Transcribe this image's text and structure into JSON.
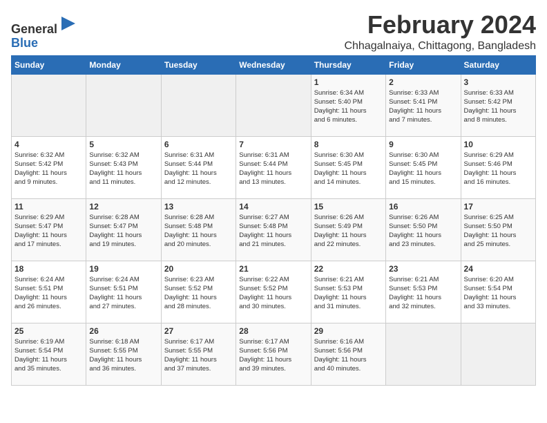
{
  "app": {
    "name_general": "General",
    "name_blue": "Blue"
  },
  "title": "February 2024",
  "location": "Chhagalnaiya, Chittagong, Bangladesh",
  "days_of_week": [
    "Sunday",
    "Monday",
    "Tuesday",
    "Wednesday",
    "Thursday",
    "Friday",
    "Saturday"
  ],
  "weeks": [
    [
      {
        "day": "",
        "info": ""
      },
      {
        "day": "",
        "info": ""
      },
      {
        "day": "",
        "info": ""
      },
      {
        "day": "",
        "info": ""
      },
      {
        "day": "1",
        "info": "Sunrise: 6:34 AM\nSunset: 5:40 PM\nDaylight: 11 hours\nand 6 minutes."
      },
      {
        "day": "2",
        "info": "Sunrise: 6:33 AM\nSunset: 5:41 PM\nDaylight: 11 hours\nand 7 minutes."
      },
      {
        "day": "3",
        "info": "Sunrise: 6:33 AM\nSunset: 5:42 PM\nDaylight: 11 hours\nand 8 minutes."
      }
    ],
    [
      {
        "day": "4",
        "info": "Sunrise: 6:32 AM\nSunset: 5:42 PM\nDaylight: 11 hours\nand 9 minutes."
      },
      {
        "day": "5",
        "info": "Sunrise: 6:32 AM\nSunset: 5:43 PM\nDaylight: 11 hours\nand 11 minutes."
      },
      {
        "day": "6",
        "info": "Sunrise: 6:31 AM\nSunset: 5:44 PM\nDaylight: 11 hours\nand 12 minutes."
      },
      {
        "day": "7",
        "info": "Sunrise: 6:31 AM\nSunset: 5:44 PM\nDaylight: 11 hours\nand 13 minutes."
      },
      {
        "day": "8",
        "info": "Sunrise: 6:30 AM\nSunset: 5:45 PM\nDaylight: 11 hours\nand 14 minutes."
      },
      {
        "day": "9",
        "info": "Sunrise: 6:30 AM\nSunset: 5:45 PM\nDaylight: 11 hours\nand 15 minutes."
      },
      {
        "day": "10",
        "info": "Sunrise: 6:29 AM\nSunset: 5:46 PM\nDaylight: 11 hours\nand 16 minutes."
      }
    ],
    [
      {
        "day": "11",
        "info": "Sunrise: 6:29 AM\nSunset: 5:47 PM\nDaylight: 11 hours\nand 17 minutes."
      },
      {
        "day": "12",
        "info": "Sunrise: 6:28 AM\nSunset: 5:47 PM\nDaylight: 11 hours\nand 19 minutes."
      },
      {
        "day": "13",
        "info": "Sunrise: 6:28 AM\nSunset: 5:48 PM\nDaylight: 11 hours\nand 20 minutes."
      },
      {
        "day": "14",
        "info": "Sunrise: 6:27 AM\nSunset: 5:48 PM\nDaylight: 11 hours\nand 21 minutes."
      },
      {
        "day": "15",
        "info": "Sunrise: 6:26 AM\nSunset: 5:49 PM\nDaylight: 11 hours\nand 22 minutes."
      },
      {
        "day": "16",
        "info": "Sunrise: 6:26 AM\nSunset: 5:50 PM\nDaylight: 11 hours\nand 23 minutes."
      },
      {
        "day": "17",
        "info": "Sunrise: 6:25 AM\nSunset: 5:50 PM\nDaylight: 11 hours\nand 25 minutes."
      }
    ],
    [
      {
        "day": "18",
        "info": "Sunrise: 6:24 AM\nSunset: 5:51 PM\nDaylight: 11 hours\nand 26 minutes."
      },
      {
        "day": "19",
        "info": "Sunrise: 6:24 AM\nSunset: 5:51 PM\nDaylight: 11 hours\nand 27 minutes."
      },
      {
        "day": "20",
        "info": "Sunrise: 6:23 AM\nSunset: 5:52 PM\nDaylight: 11 hours\nand 28 minutes."
      },
      {
        "day": "21",
        "info": "Sunrise: 6:22 AM\nSunset: 5:52 PM\nDaylight: 11 hours\nand 30 minutes."
      },
      {
        "day": "22",
        "info": "Sunrise: 6:21 AM\nSunset: 5:53 PM\nDaylight: 11 hours\nand 31 minutes."
      },
      {
        "day": "23",
        "info": "Sunrise: 6:21 AM\nSunset: 5:53 PM\nDaylight: 11 hours\nand 32 minutes."
      },
      {
        "day": "24",
        "info": "Sunrise: 6:20 AM\nSunset: 5:54 PM\nDaylight: 11 hours\nand 33 minutes."
      }
    ],
    [
      {
        "day": "25",
        "info": "Sunrise: 6:19 AM\nSunset: 5:54 PM\nDaylight: 11 hours\nand 35 minutes."
      },
      {
        "day": "26",
        "info": "Sunrise: 6:18 AM\nSunset: 5:55 PM\nDaylight: 11 hours\nand 36 minutes."
      },
      {
        "day": "27",
        "info": "Sunrise: 6:17 AM\nSunset: 5:55 PM\nDaylight: 11 hours\nand 37 minutes."
      },
      {
        "day": "28",
        "info": "Sunrise: 6:17 AM\nSunset: 5:56 PM\nDaylight: 11 hours\nand 39 minutes."
      },
      {
        "day": "29",
        "info": "Sunrise: 6:16 AM\nSunset: 5:56 PM\nDaylight: 11 hours\nand 40 minutes."
      },
      {
        "day": "",
        "info": ""
      },
      {
        "day": "",
        "info": ""
      }
    ]
  ]
}
